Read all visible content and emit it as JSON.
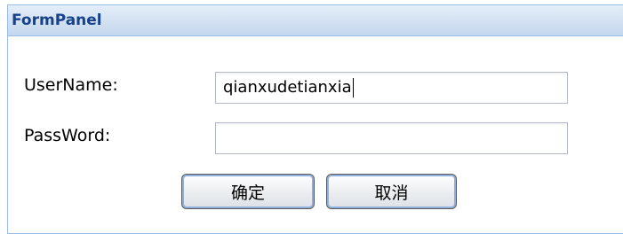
{
  "panel": {
    "title": "FormPanel"
  },
  "form": {
    "username_label": "UserName:",
    "username_value": "qianxudetianxia",
    "password_label": "PassWord:",
    "password_value": ""
  },
  "buttons": {
    "ok_label": "确定",
    "cancel_label": "取消"
  },
  "colors": {
    "panel_border": "#99bbe8",
    "title_text": "#15428b",
    "field_border": "#b5b8c8"
  }
}
